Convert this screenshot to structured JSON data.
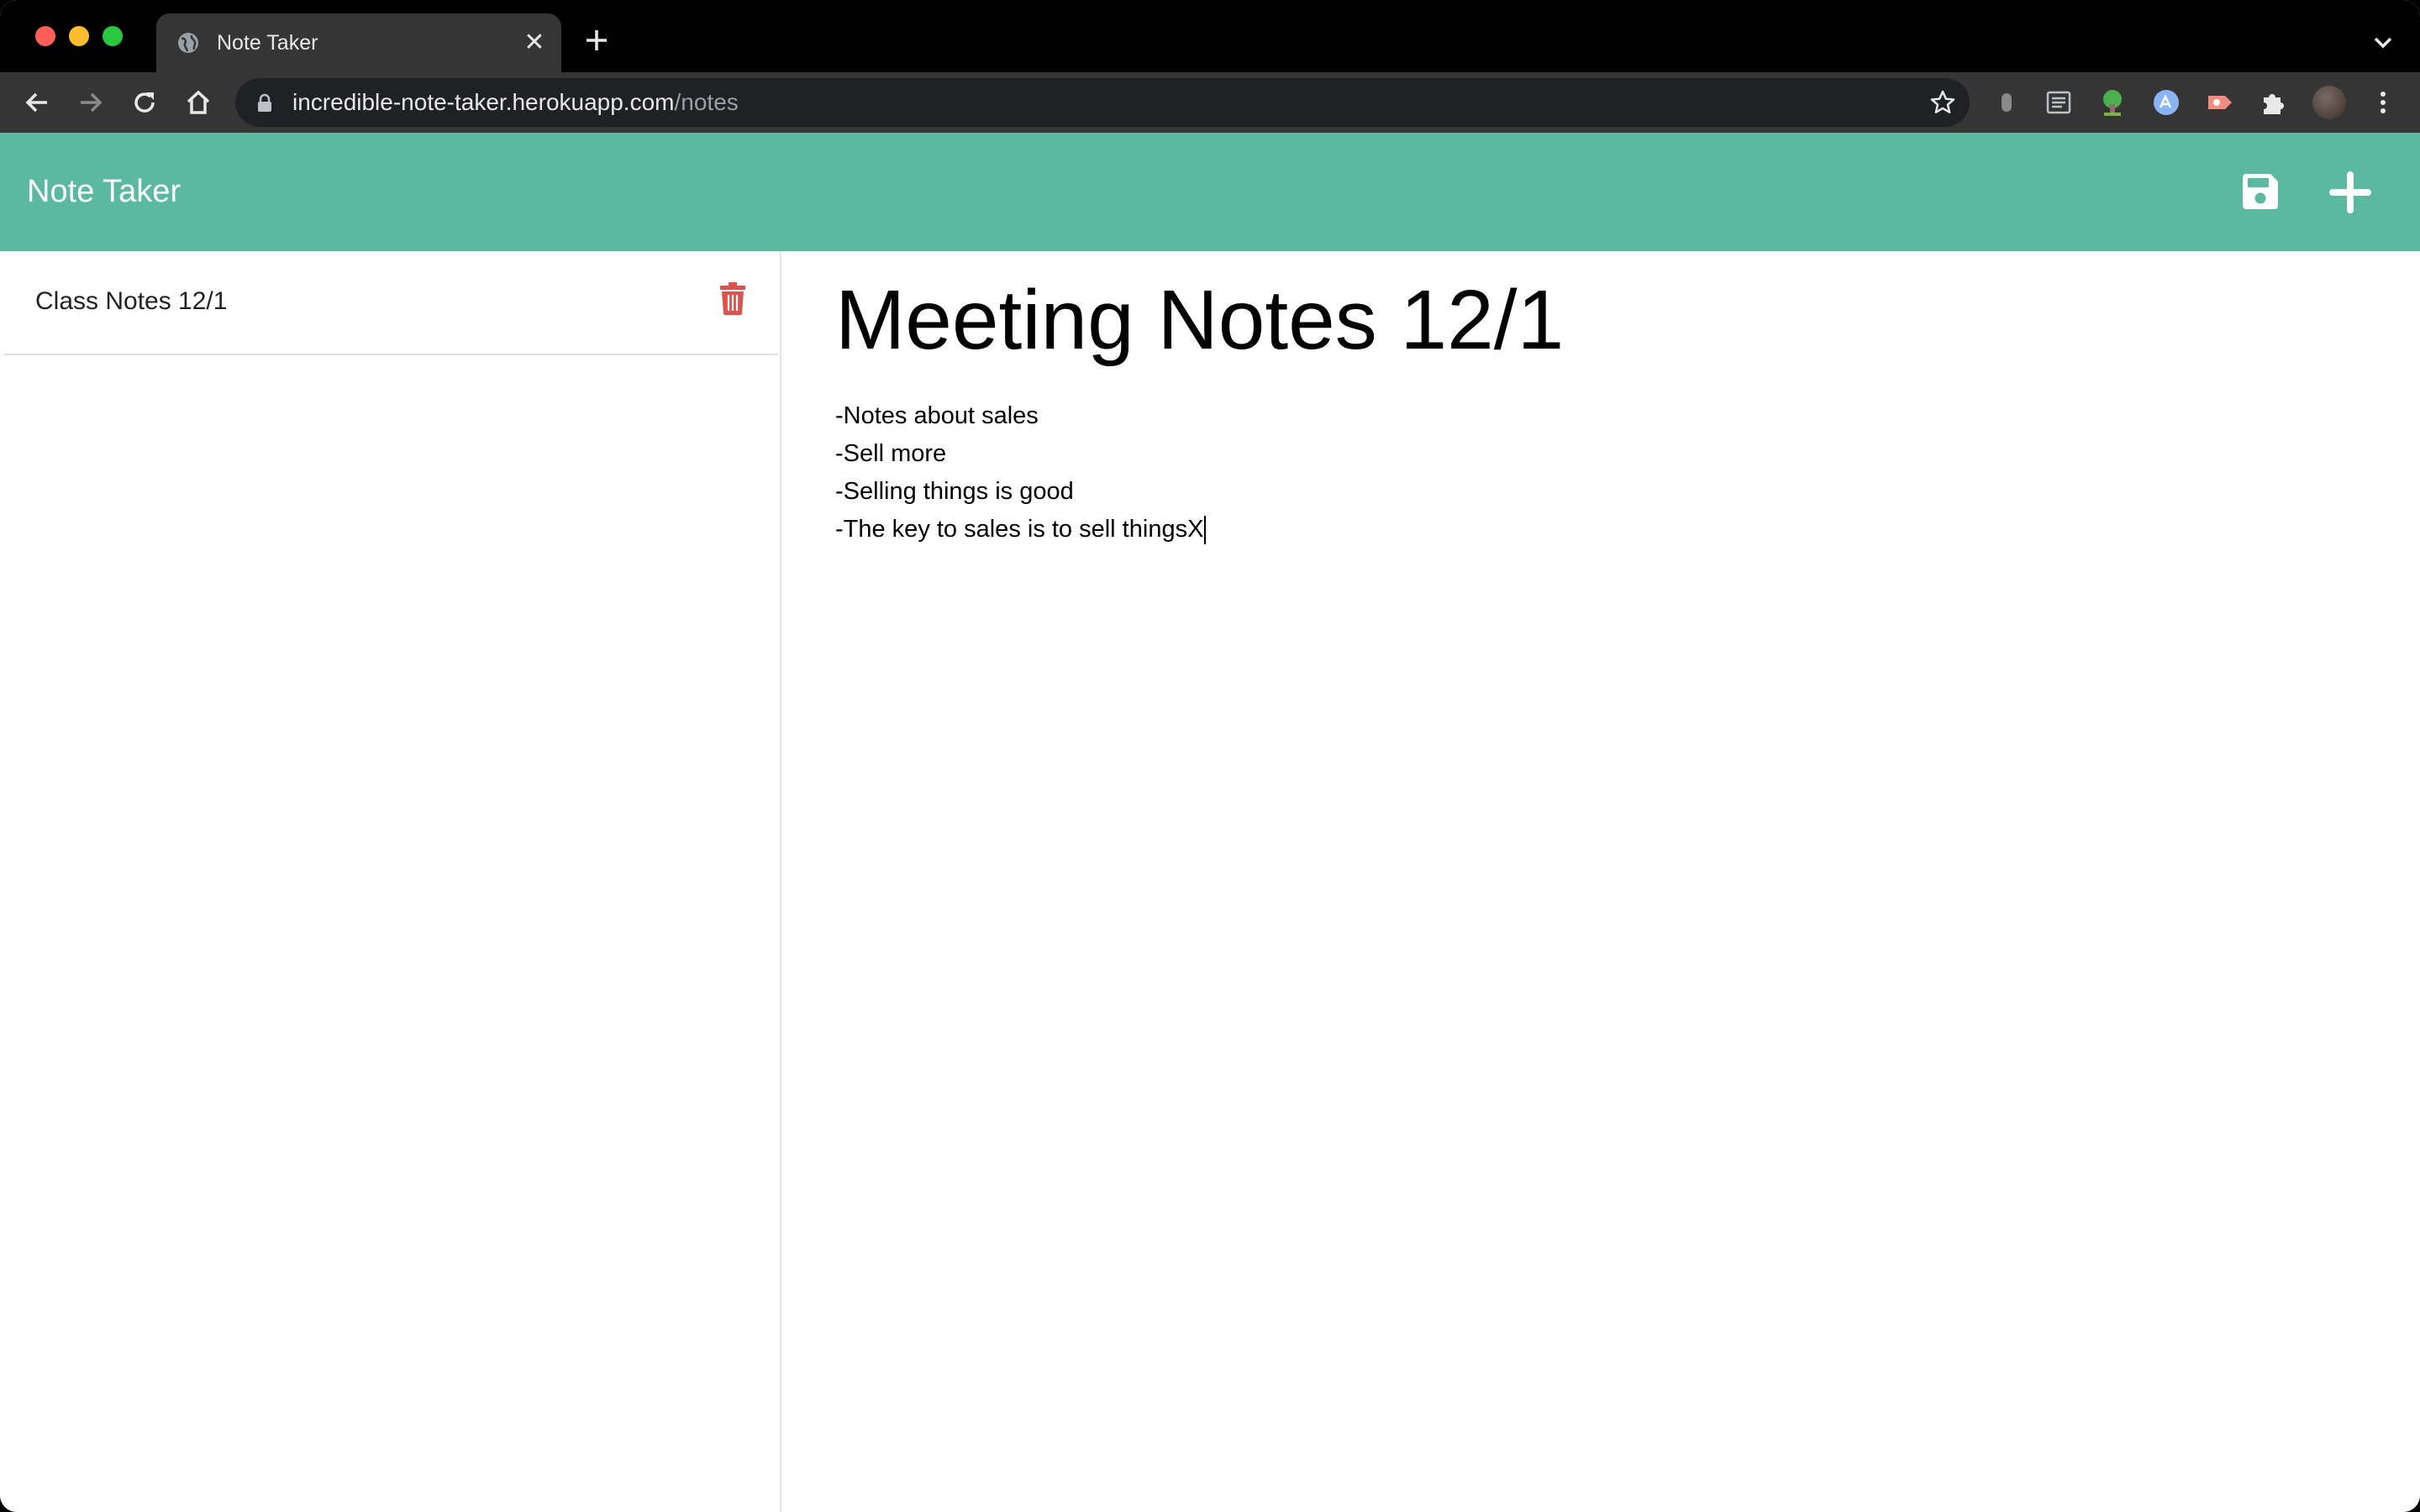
{
  "browser": {
    "tab": {
      "title": "Note Taker",
      "favicon": "globe-icon"
    },
    "address_bar": {
      "host": "incredible-note-taker.herokuapp.com",
      "path": "/notes"
    },
    "toolbar_icons": [
      "back-icon",
      "forward-icon",
      "reload-icon",
      "home-icon",
      "bookmark-star-icon",
      "extensions-puzzle-icon",
      "profile-avatar",
      "menu-kebab-icon"
    ]
  },
  "app": {
    "brand": "Note Taker",
    "header_color": "#5ab99e",
    "actions": {
      "save_icon": "floppy-disk-icon",
      "new_icon": "plus-icon"
    },
    "sidebar": {
      "notes": [
        {
          "title": "Class Notes 12/1",
          "delete_icon": "trash-icon",
          "delete_color": "#d9534f"
        }
      ]
    },
    "editor": {
      "title": "Meeting Notes 12/1",
      "text": "-Notes about sales\n-Sell more\n-Selling things is good\n-The key to sales is to sell thingsX"
    }
  }
}
